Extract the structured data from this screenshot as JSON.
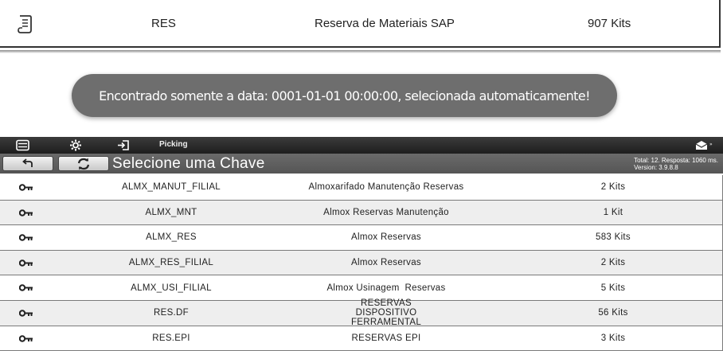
{
  "top_row": {
    "icon": "scroll-icon",
    "code": "RES",
    "description": "Reserva de Materiais SAP",
    "kits": "907 Kits"
  },
  "toast": {
    "message": "Encontrado somente a data: 0001-01-01 00:00:00, selecionada automaticamente!"
  },
  "toolbar": {
    "icons": [
      "menu-icon",
      "settings-icon",
      "login-icon"
    ],
    "label": "Picking",
    "right_icon": "inbox-icon"
  },
  "subbar": {
    "title": "Selecione uma Chave",
    "meta_line1": "Total: 12. Resposta: 1060 ms.",
    "meta_line2": "Version: 3.9.8.8"
  },
  "rows": [
    {
      "name": "ALMX_MANUT_FILIAL",
      "description": "Almoxarifado Manutenção Reservas",
      "kits": "2 Kits"
    },
    {
      "name": "ALMX_MNT",
      "description": "Almox Reservas Manutenção",
      "kits": "1 Kit"
    },
    {
      "name": "ALMX_RES",
      "description": "Almox Reservas",
      "kits": "583 Kits"
    },
    {
      "name": "ALMX_RES_FILIAL",
      "description": "Almox Reservas",
      "kits": "2 Kits"
    },
    {
      "name": "ALMX_USI_FILIAL",
      "description": "Almox Usinagem  Reservas",
      "kits": "5 Kits"
    },
    {
      "name": "RES.DF",
      "description": "RESERVAS DISPOSITIVO FERRAMENTAL",
      "kits": "56 Kits"
    },
    {
      "name": "RES.EPI",
      "description": "RESERVAS EPI",
      "kits": "3 Kits"
    }
  ]
}
